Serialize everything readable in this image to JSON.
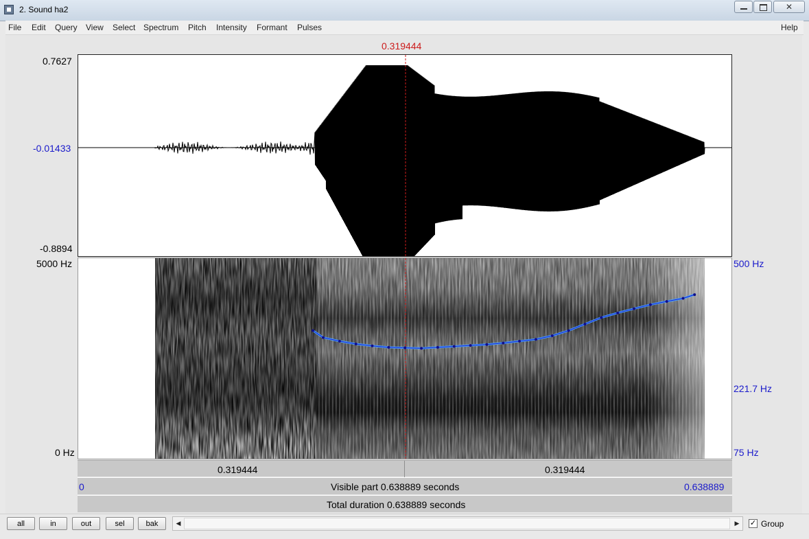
{
  "window": {
    "title": "2. Sound ha2"
  },
  "menu": [
    "File",
    "Edit",
    "Query",
    "View",
    "Select",
    "Spectrum",
    "Pitch",
    "Intensity",
    "Formant",
    "Pulses"
  ],
  "help": "Help",
  "cursor": {
    "time": "0.319444",
    "fraction": 0.5
  },
  "waveform": {
    "max": "0.7627",
    "zero": "-0.01433",
    "min": "-0.8894"
  },
  "spectrogram": {
    "top": "5000 Hz",
    "bottom": "0 Hz"
  },
  "pitch_axis": {
    "top": "500 Hz",
    "mid": "221.7 Hz",
    "bottom": "75 Hz"
  },
  "time_bar": {
    "left": "0.319444",
    "right": "0.319444"
  },
  "visible": {
    "start": "0",
    "label": "Visible part 0.638889 seconds",
    "end": "0.638889"
  },
  "total": {
    "label": "Total duration 0.638889 seconds"
  },
  "buttons": {
    "all": "all",
    "in": "in",
    "out": "out",
    "sel": "sel",
    "bak": "bak"
  },
  "scroll": {
    "left_arrow": "◀",
    "right_arrow": "▶"
  },
  "group": {
    "label": "Group",
    "checked": true
  },
  "chart_data": {
    "type": "line",
    "title": "",
    "xlabel": "",
    "ylabel": "",
    "xlim": [
      0,
      0.638889
    ],
    "ylim": [
      75,
      500
    ],
    "yscale": "log",
    "series": [
      {
        "x": [
          0.2296,
          0.2396,
          0.2556,
          0.2716,
          0.2876,
          0.3036,
          0.3196,
          0.3356,
          0.3516,
          0.3676,
          0.3836,
          0.3996,
          0.4156,
          0.4316,
          0.4476,
          0.4636,
          0.4796,
          0.4956,
          0.5116,
          0.5276,
          0.5436,
          0.5596,
          0.5756,
          0.5916,
          0.6028
        ],
        "values": [
          252,
          236,
          228,
          222,
          218,
          215,
          214,
          213,
          215,
          217,
          219,
          221,
          224,
          228,
          232,
          240,
          252,
          268,
          285,
          298,
          310,
          322,
          332,
          342,
          354
        ]
      }
    ]
  }
}
